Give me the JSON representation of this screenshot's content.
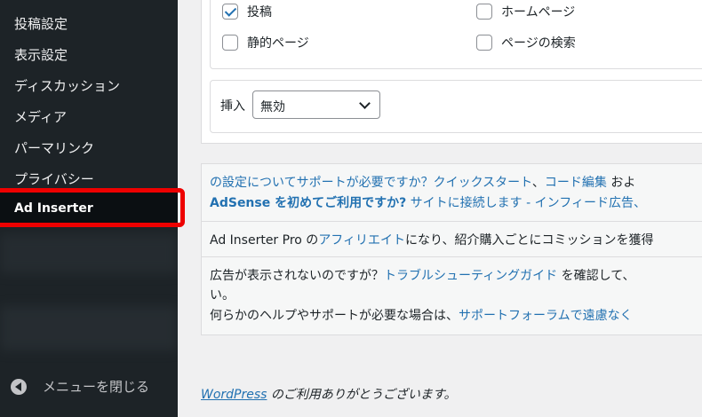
{
  "sidebar": {
    "items": [
      {
        "label": "投稿設定"
      },
      {
        "label": "表示設定"
      },
      {
        "label": "ディスカッション"
      },
      {
        "label": "メディア"
      },
      {
        "label": "パーマリンク"
      },
      {
        "label": "プライバシー"
      }
    ],
    "current_item": "Ad Inserter",
    "collapse_label": "メニューを閉じる"
  },
  "settings": {
    "checkboxes": [
      {
        "label": "投稿",
        "checked": true
      },
      {
        "label": "ホームページ",
        "checked": false
      },
      {
        "label": "静的ページ",
        "checked": false
      },
      {
        "label": "ページの検索",
        "checked": false
      }
    ],
    "insert_label": "挿入",
    "insert_select_value": "無効"
  },
  "help": {
    "line1": {
      "a": "の設定についてサポートが必要ですか？",
      "b": "クイックスタート",
      "c": "、",
      "d": "コード編集",
      "e": " およ"
    },
    "line2": {
      "a": "AdSense を初めてご利用ですか?",
      "b": " サイトに接続します",
      "c": " - ",
      "d": "インフィード広告、"
    },
    "line3": {
      "a": "Ad Inserter Pro の",
      "b": "アフィリエイト",
      "c": "になり、紹介購入ごとにコミッションを獲得"
    },
    "line4": {
      "a": "広告が表示されないのですが？",
      "b": "トラブルシューティングガイド",
      "c": " を確認して、"
    },
    "line5": "い。",
    "line6": {
      "a": "何らかのヘルプやサポートが必要な場合は、",
      "b": "サポートフォーラムで遠慮なく"
    }
  },
  "footer": {
    "link": "WordPress",
    "text": " のご利用ありがとうございます。"
  }
}
